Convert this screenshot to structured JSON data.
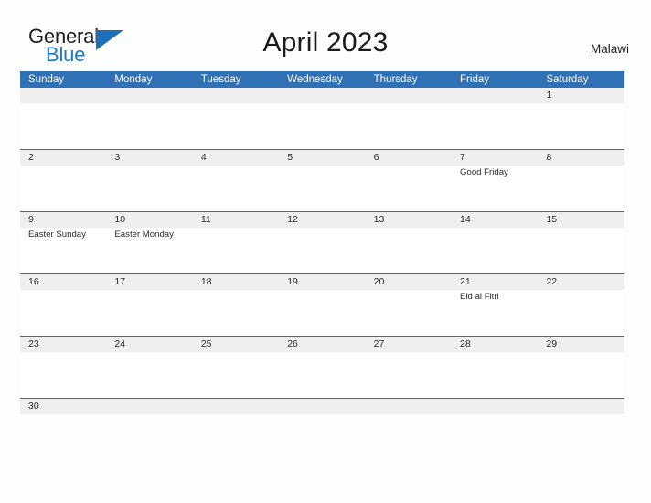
{
  "brand": {
    "name_part1": "General",
    "name_part2": "Blue",
    "triangle_icon": "triangle-icon",
    "accent_color": "#1d6fb8",
    "text_color": "#231f20"
  },
  "header": {
    "title": "April 2023",
    "region": "Malawi"
  },
  "calendar": {
    "month": "April",
    "year": "2023",
    "header_bg": "#3070b4",
    "date_strip_bg": "#efefef",
    "separator_color": "#2f6fb3",
    "day_names": [
      "Sunday",
      "Monday",
      "Tuesday",
      "Wednesday",
      "Thursday",
      "Friday",
      "Saturday"
    ],
    "weeks": [
      [
        {
          "date": "",
          "event": ""
        },
        {
          "date": "",
          "event": ""
        },
        {
          "date": "",
          "event": ""
        },
        {
          "date": "",
          "event": ""
        },
        {
          "date": "",
          "event": ""
        },
        {
          "date": "",
          "event": ""
        },
        {
          "date": "1",
          "event": ""
        }
      ],
      [
        {
          "date": "2",
          "event": ""
        },
        {
          "date": "3",
          "event": ""
        },
        {
          "date": "4",
          "event": ""
        },
        {
          "date": "5",
          "event": ""
        },
        {
          "date": "6",
          "event": ""
        },
        {
          "date": "7",
          "event": "Good Friday"
        },
        {
          "date": "8",
          "event": ""
        }
      ],
      [
        {
          "date": "9",
          "event": "Easter Sunday"
        },
        {
          "date": "10",
          "event": "Easter Monday"
        },
        {
          "date": "11",
          "event": ""
        },
        {
          "date": "12",
          "event": ""
        },
        {
          "date": "13",
          "event": ""
        },
        {
          "date": "14",
          "event": ""
        },
        {
          "date": "15",
          "event": ""
        }
      ],
      [
        {
          "date": "16",
          "event": ""
        },
        {
          "date": "17",
          "event": ""
        },
        {
          "date": "18",
          "event": ""
        },
        {
          "date": "19",
          "event": ""
        },
        {
          "date": "20",
          "event": ""
        },
        {
          "date": "21",
          "event": "Eid al Fitri"
        },
        {
          "date": "22",
          "event": ""
        }
      ],
      [
        {
          "date": "23",
          "event": ""
        },
        {
          "date": "24",
          "event": ""
        },
        {
          "date": "25",
          "event": ""
        },
        {
          "date": "26",
          "event": ""
        },
        {
          "date": "27",
          "event": ""
        },
        {
          "date": "28",
          "event": ""
        },
        {
          "date": "29",
          "event": ""
        }
      ],
      [
        {
          "date": "30",
          "event": ""
        },
        {
          "date": "",
          "event": ""
        },
        {
          "date": "",
          "event": ""
        },
        {
          "date": "",
          "event": ""
        },
        {
          "date": "",
          "event": ""
        },
        {
          "date": "",
          "event": ""
        },
        {
          "date": "",
          "event": ""
        }
      ]
    ]
  }
}
